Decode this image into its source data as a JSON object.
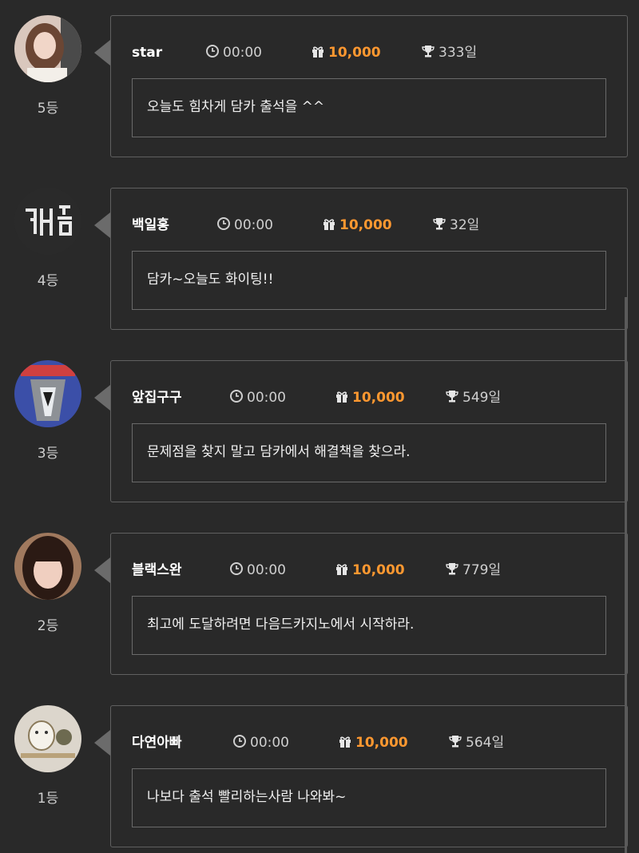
{
  "entries": [
    {
      "rank": "5등",
      "name": "star",
      "time": "00:00",
      "gift": "10,000",
      "days": "333일",
      "message": "오늘도 힘차게 담카 출석을 ^^"
    },
    {
      "rank": "4등",
      "name": "백일홍",
      "time": "00:00",
      "gift": "10,000",
      "days": "32일",
      "message": "담카~오늘도 화이팅!!"
    },
    {
      "rank": "3등",
      "name": "앞집구구",
      "time": "00:00",
      "gift": "10,000",
      "days": "549일",
      "message": "문제점을 찾지 말고 담카에서 해결책을 찾으라."
    },
    {
      "rank": "2등",
      "name": "블랙스완",
      "time": "00:00",
      "gift": "10,000",
      "days": "779일",
      "message": "최고에 도달하려면 다음드카지노에서 시작하라."
    },
    {
      "rank": "1등",
      "name": "다연아빠",
      "time": "00:00",
      "gift": "10,000",
      "days": "564일",
      "message": "나보다 출석 빨리하는사람 나와봐~"
    }
  ],
  "avatar_palettes": [
    {
      "bg": "#d9c7bd",
      "fg": "#5a3a2e"
    },
    {
      "bg": "#2a2a2a",
      "fg": "#e8e8e8"
    },
    {
      "bg": "#3b4fa8",
      "fg": "#9aa0a6"
    },
    {
      "bg": "#a0795e",
      "fg": "#2b1a14"
    },
    {
      "bg": "#dcd6cc",
      "fg": "#6d6a50"
    }
  ],
  "colors": {
    "background": "#292929",
    "accent_gift": "#ff9830",
    "border": "#606060"
  },
  "icons": {
    "time": "clock-icon",
    "gift": "gift-icon",
    "days": "trophy-icon"
  }
}
